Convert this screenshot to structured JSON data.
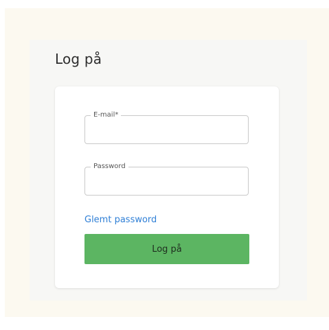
{
  "page": {
    "title": "Log på"
  },
  "form": {
    "email": {
      "label": "E-mail*",
      "value": ""
    },
    "password": {
      "label": "Password",
      "value": ""
    },
    "forgot_password_label": "Glemt password",
    "submit_label": "Log på"
  },
  "colors": {
    "outer_background": "#fcf9f0",
    "panel_background": "#f7f7f5",
    "link": "#2f7fd6",
    "button": "#5cb562"
  }
}
